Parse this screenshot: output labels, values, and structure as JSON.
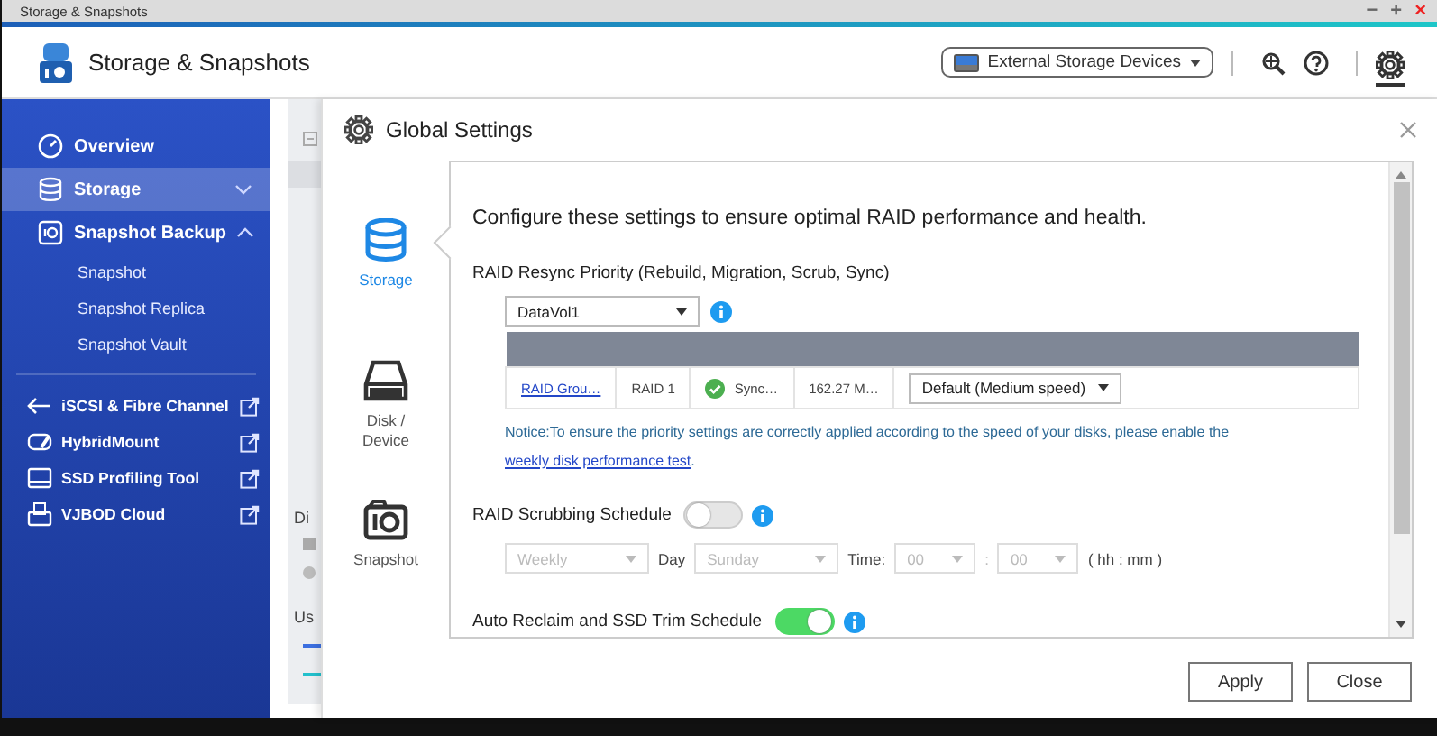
{
  "window": {
    "title": "Storage & Snapshots",
    "controls": [
      "−",
      "+",
      "×"
    ]
  },
  "header": {
    "app_title": "Storage & Snapshots",
    "device_menu": "External Storage Devices"
  },
  "sidebar": {
    "items": [
      {
        "label": "Overview",
        "selected": false
      },
      {
        "label": "Storage",
        "selected": true,
        "expanded": false
      },
      {
        "label": "Snapshot Backup",
        "selected": false,
        "expanded": true,
        "children": [
          {
            "label": "Snapshot",
            "selected": false
          },
          {
            "label": "Snapshot Replica",
            "selected": false
          },
          {
            "label": "Snapshot Vault",
            "selected": false
          }
        ]
      }
    ],
    "tools": [
      {
        "label": "iSCSI & Fibre Channel"
      },
      {
        "label": "HybridMount"
      },
      {
        "label": "SSD Profiling Tool"
      },
      {
        "label": "VJBOD Cloud"
      }
    ]
  },
  "background_panel": {
    "labels": [
      "Di",
      "Us"
    ]
  },
  "dialog": {
    "title": "Global Settings",
    "tabs": [
      {
        "label": "Storage",
        "selected": true
      },
      {
        "label": "Disk / Device",
        "selected": false
      },
      {
        "label": "Snapshot",
        "selected": false
      }
    ],
    "intro": "Configure these settings to ensure optimal RAID performance and health.",
    "resync": {
      "heading": "RAID Resync Priority (Rebuild, Migration, Scrub, Sync)",
      "volume": "DataVol1",
      "rows": [
        {
          "cells": [
            "RAID Grou…",
            "RAID 1",
            "Sync…",
            "162.27 M…"
          ],
          "priority": "Default (Medium speed)"
        }
      ],
      "notice": "Notice:To ensure the priority settings are correctly applied according to the speed of your disks, please enable the ",
      "notice_link": "weekly disk performance test",
      "notice_end": "."
    },
    "scrubbing": {
      "heading": "RAID Scrubbing Schedule",
      "on": false,
      "disabled": true,
      "frequency": "Weekly",
      "day_label": "Day",
      "day": "Sunday",
      "time_label": "Time:",
      "hour": "00",
      "separator": ":",
      "minute": "00",
      "format": "( hh : mm )"
    },
    "trim": {
      "heading": "Auto Reclaim and SSD Trim Schedule",
      "on": true
    },
    "buttons": [
      "Apply",
      "Close"
    ]
  }
}
